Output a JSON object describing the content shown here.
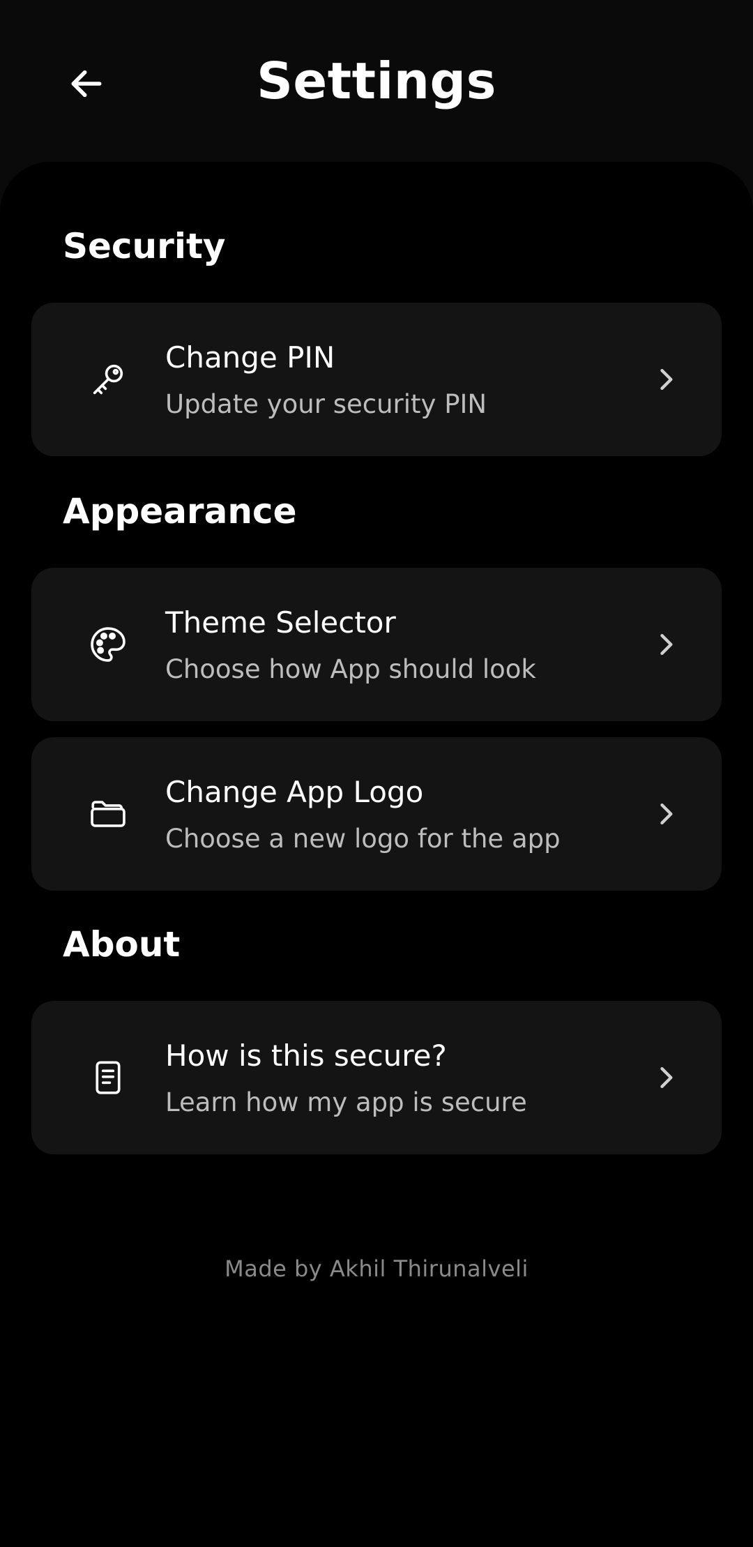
{
  "header": {
    "title": "Settings",
    "back_icon": "arrow-left-icon"
  },
  "sections": [
    {
      "title": "Security",
      "items": [
        {
          "title": "Change PIN",
          "subtitle": "Update your security PIN",
          "icon": "key-icon"
        }
      ]
    },
    {
      "title": "Appearance",
      "items": [
        {
          "title": "Theme Selector",
          "subtitle": "Choose how App should look",
          "icon": "palette-icon"
        },
        {
          "title": "Change App Logo",
          "subtitle": "Choose a new logo for the app",
          "icon": "folder-icon"
        }
      ]
    },
    {
      "title": "About",
      "items": [
        {
          "title": "How is this secure?",
          "subtitle": "Learn how my app is secure",
          "icon": "document-icon"
        }
      ]
    }
  ],
  "footer": {
    "text": "Made by Akhil Thirunalveli"
  },
  "colors": {
    "background": "#0a0a0a",
    "content_background": "#000000",
    "card": "#141414",
    "text_primary": "#ffffff",
    "text_secondary": "#bdbdbd",
    "footer_text": "#8a8a8a"
  }
}
